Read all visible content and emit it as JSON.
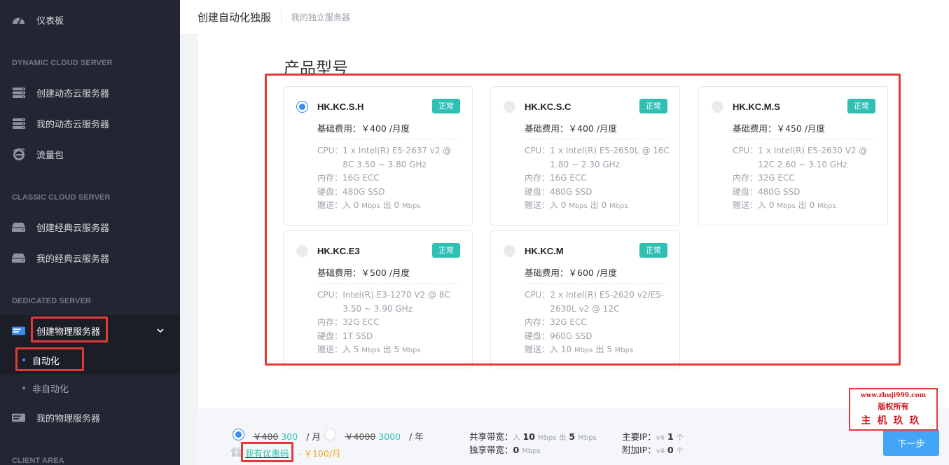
{
  "sidebar": {
    "dashboard": "仪表板",
    "section_dynamic": "DYNAMIC CLOUD SERVER",
    "create_dynamic": "创建动态云服务器",
    "my_dynamic": "我的动态云服务器",
    "traffic": "流量包",
    "section_classic": "CLASSIC CLOUD SERVER",
    "create_classic": "创建经典云服务器",
    "my_classic": "我的经典云服务器",
    "section_dedicated": "DEDICATED SERVER",
    "create_dedicated": "创建物理服务器",
    "sub_auto": "自动化",
    "sub_manual": "非自动化",
    "my_dedicated": "我的物理服务器",
    "section_client": "CLIENT AREA"
  },
  "header": {
    "title": "创建自动化独服",
    "breadcrumb": "我的独立服务器"
  },
  "main": {
    "section_title": "产品型号",
    "labels": {
      "cpu": "CPU：",
      "mem": "内存：",
      "disk": "硬盘：",
      "gift": "赠送：",
      "in": "入",
      "out": "出",
      "mbps": "Mbps"
    },
    "products": [
      {
        "name": "HK.KC.S.H",
        "status": "正常",
        "fee": "基础费用：￥400 /月度",
        "cpu": "1 x Intel(R) E5-2637 v2 @ 8C 3.50 ~ 3.80 GHz",
        "mem": "16G ECC",
        "disk": "480G SSD",
        "bw_in": "0",
        "bw_out": "0",
        "selected": true
      },
      {
        "name": "HK.KC.S.C",
        "status": "正常",
        "fee": "基础费用：￥400 /月度",
        "cpu": "1 x Intel(R) E5-2650L @ 16C 1.80 ~ 2.30 GHz",
        "mem": "16G ECC",
        "disk": "480G SSD",
        "bw_in": "0",
        "bw_out": "0",
        "selected": false
      },
      {
        "name": "HK.KC.M.S",
        "status": "正常",
        "fee": "基础费用：￥450 /月度",
        "cpu": "1 x Intel(R) E5-2630 V2 @ 12C 2.60 ~ 3.10 GHz",
        "mem": "32G ECC",
        "disk": "480G SSD",
        "bw_in": "0",
        "bw_out": "0",
        "selected": false
      },
      {
        "name": "HK.KC.E3",
        "status": "正常",
        "fee": "基础费用：￥500 /月度",
        "cpu": "Intel(R) E3-1270 V2 @ 8C 3.50 ~ 3.90 GHz",
        "mem": "32G ECC",
        "disk": "1T SSD",
        "bw_in": "5",
        "bw_out": "5",
        "selected": false
      },
      {
        "name": "HK.KC.M",
        "status": "正常",
        "fee": "基础费用：￥600 /月度",
        "cpu": "2 x Intel(R) E5-2620 v2/E5-2630L v2 @ 12C",
        "mem": "32G ECC",
        "disk": "960G SSD",
        "bw_in": "10",
        "bw_out": "5",
        "selected": false
      }
    ]
  },
  "footer": {
    "monthly_old": "￥400",
    "monthly_new": "300",
    "monthly_unit": "/ 月",
    "yearly_old": "￥4000",
    "yearly_new": "3000",
    "yearly_unit": "/ 年",
    "coupon_link": "我有优惠码",
    "coupon_discount": "- ￥100/月",
    "shared_bw_label": "共享带宽：",
    "shared_in_label": "入",
    "shared_in_value": "10",
    "shared_out_label": "出",
    "shared_out_value": "5",
    "mbps": "Mbps",
    "exclusive_bw_label": "独享带宽：",
    "exclusive_value": "0",
    "main_ip_label": "主要IP：",
    "main_ip_proto": "v4",
    "main_ip_value": "1",
    "extra_ip_label": "附加IP：",
    "extra_ip_proto": "v4",
    "extra_ip_value": "0",
    "ip_unit": "个",
    "next_button": "下一步"
  },
  "watermark": {
    "line1": "www.zhuji999.com",
    "line2": "版权所有",
    "line3": "主机玖玖"
  }
}
